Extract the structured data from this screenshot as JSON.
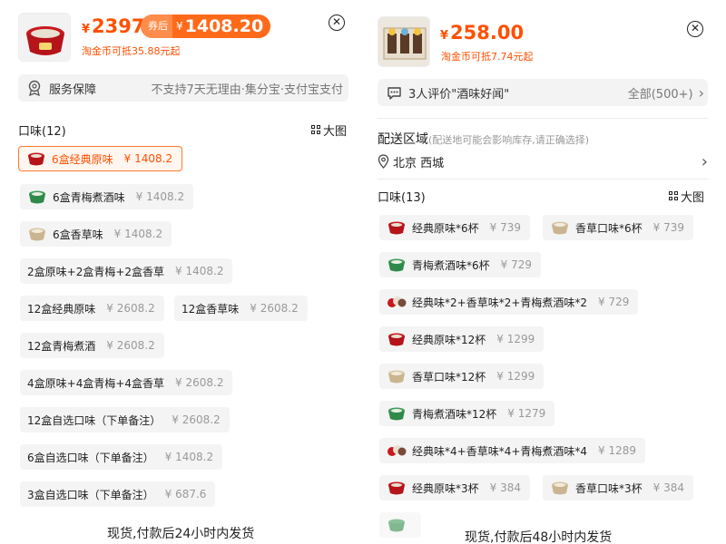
{
  "left": {
    "header": {
      "price": "2397",
      "currency": "¥",
      "coupon_tag": "券后",
      "coupon_price": "1408.20",
      "coin_text": "淘金币可抵35.88元起",
      "close_glyph": "✕"
    },
    "service": {
      "label": "服务保障",
      "detail": "不支持7天无理由·集分宝·支付宝支付"
    },
    "flavor_title": "口味(12)",
    "big_pic_label": "大图",
    "options": [
      {
        "label": "6盒经典原味",
        "price": "¥ 1408.2",
        "selected": true,
        "cup": "red"
      },
      {
        "label": "6盒青梅煮酒味",
        "price": "¥ 1408.2",
        "selected": false,
        "cup": "green"
      },
      {
        "label": "6盒香草味",
        "price": "¥ 1408.2",
        "selected": false,
        "cup": "beige"
      },
      {
        "label": "2盒原味+2盒青梅+2盒香草",
        "price": "¥ 1408.2",
        "selected": false,
        "cup": ""
      },
      {
        "label": "12盒经典原味",
        "price": "¥ 2608.2",
        "selected": false,
        "cup": ""
      },
      {
        "label": "12盒香草味",
        "price": "¥ 2608.2",
        "selected": false,
        "cup": ""
      },
      {
        "label": "12盒青梅煮酒",
        "price": "¥ 2608.2",
        "selected": false,
        "cup": ""
      },
      {
        "label": "4盒原味+4盒青梅+4盒香草",
        "price": "¥ 2608.2",
        "selected": false,
        "cup": ""
      },
      {
        "label": "12盒自选口味（下单备注）",
        "price": "¥ 2608.2",
        "selected": false,
        "cup": ""
      },
      {
        "label": "6盒自选口味（下单备注）",
        "price": "¥ 1408.2",
        "selected": false,
        "cup": ""
      },
      {
        "label": "3盒自选口味（下单备注）",
        "price": "¥ 687.6",
        "selected": false,
        "cup": ""
      }
    ],
    "footer": "现货,付款后24小时内发货"
  },
  "right": {
    "header": {
      "price": "258.00",
      "currency": "¥",
      "coin_text": "淘金币可抵7.74元起",
      "close_glyph": "✕"
    },
    "review": {
      "text": "3人评价\"酒味好闻\"",
      "all_label": "全部(500+)"
    },
    "delivery": {
      "title": "配送区域",
      "hint": "(配送地可能会影响库存,请正确选择)",
      "location": "北京 西城"
    },
    "flavor_title": "口味(13)",
    "big_pic_label": "大图",
    "options": [
      {
        "label": "经典原味*6杯",
        "price": "¥ 739",
        "cup": "red"
      },
      {
        "label": "香草口味*6杯",
        "price": "¥ 739",
        "cup": "beige"
      },
      {
        "label": "青梅煮酒味*6杯",
        "price": "¥ 729",
        "cup": "green"
      },
      {
        "label": "经典味*2+香草味*2+青梅煮酒味*2",
        "price": "¥ 729",
        "cup": "mix"
      },
      {
        "label": "经典原味*12杯",
        "price": "¥ 1299",
        "cup": "red"
      },
      {
        "label": "香草口味*12杯",
        "price": "¥ 1299",
        "cup": "beige"
      },
      {
        "label": "青梅煮酒味*12杯",
        "price": "¥ 1279",
        "cup": "green"
      },
      {
        "label": "经典味*4+香草味*4+青梅煮酒味*4",
        "price": "¥ 1289",
        "cup": "mix"
      },
      {
        "label": "经典原味*3杯",
        "price": "¥ 384",
        "cup": "red"
      },
      {
        "label": "香草口味*3杯",
        "price": "¥ 384",
        "cup": "beige"
      }
    ],
    "footer": "现货,付款后48小时内发货"
  },
  "colors": {
    "accent": "#ff5000",
    "selected_border": "#ff7a2e",
    "chip_bg": "#f4f4f4",
    "price_grey": "#999999"
  }
}
